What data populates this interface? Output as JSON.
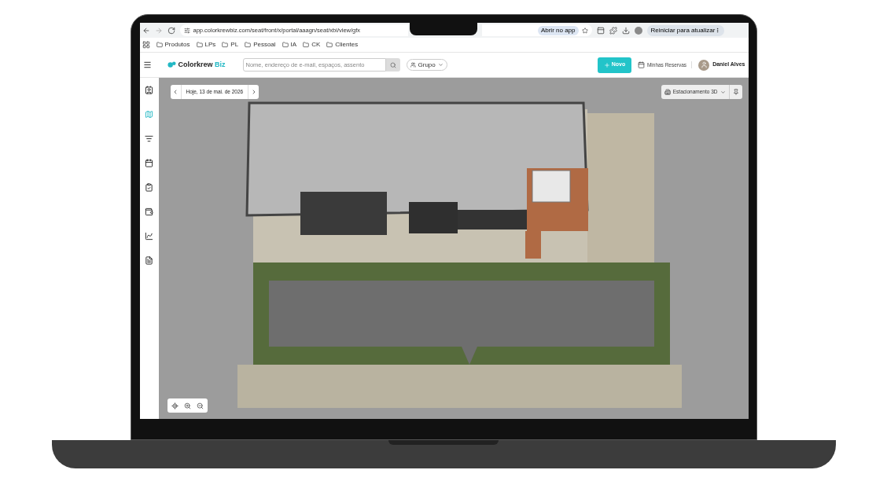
{
  "browser": {
    "url": "app.colorkrewbiz.com/seat/front/x/portal/aaagn/seat/xbi/view/gfx",
    "open_app": "Abrir no app",
    "update": "Reiniciar para atualizar"
  },
  "bookmarks": [
    "Produtos",
    "LPs",
    "PL",
    "Pessoal",
    "IA",
    "CK",
    "Clientes"
  ],
  "header": {
    "logo": "Colorkrew",
    "logo_suffix": "Biz",
    "search": {
      "placeholder": "Nome, endereço de e-mail, espaços, assento"
    },
    "group": "Grupo",
    "new_button": "Novo",
    "reservations": "Minhas Reservas",
    "user": "Daniel Alves"
  },
  "sidebar": {
    "items": [
      {
        "kind": "badge",
        "selected": false
      },
      {
        "kind": "map",
        "selected": true
      },
      {
        "kind": "filter",
        "selected": false
      },
      {
        "kind": "calendar",
        "selected": false
      },
      {
        "kind": "clipboard",
        "selected": false
      },
      {
        "kind": "wallet",
        "selected": false
      },
      {
        "kind": "chart",
        "selected": false
      },
      {
        "kind": "file",
        "selected": false
      }
    ]
  },
  "map": {
    "date": "Hoje, 13 de mai. de 2026",
    "layer": "Estacionamento 3D"
  }
}
